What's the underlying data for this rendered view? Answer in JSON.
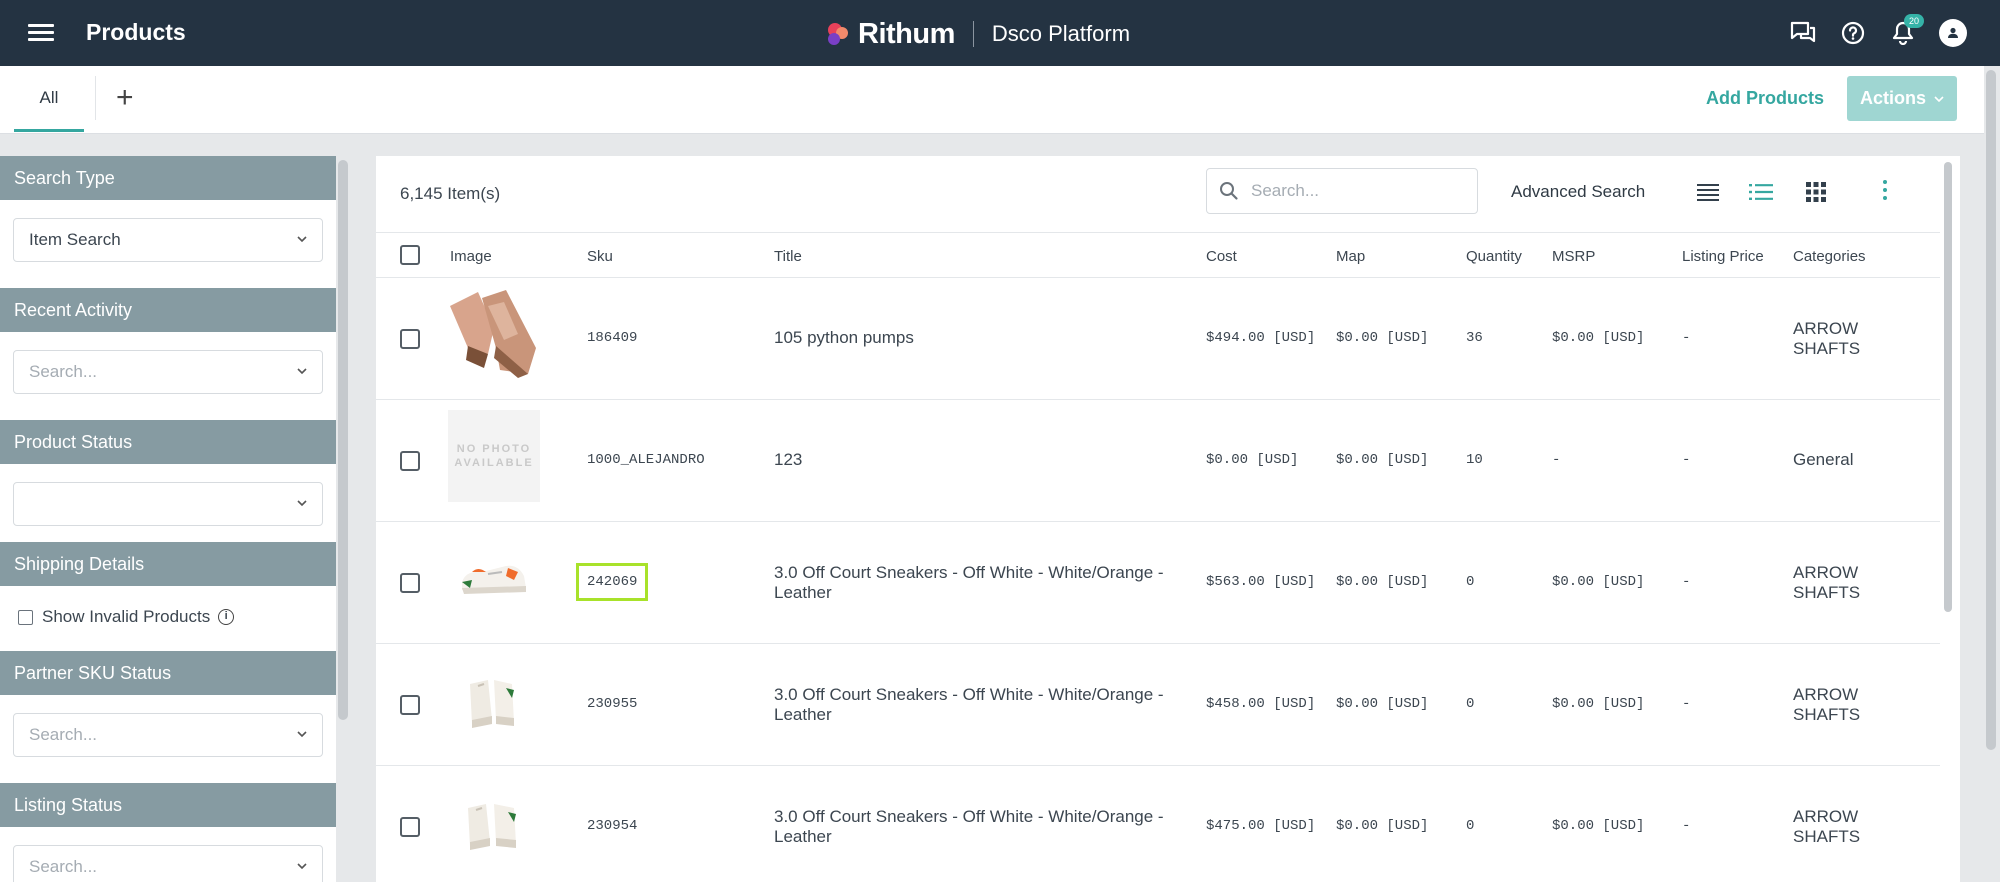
{
  "header": {
    "title": "Products",
    "brand_name": "Rithum",
    "platform": "Dsco Platform",
    "notification_count": "20"
  },
  "tabs": {
    "all_label": "All",
    "add_label": "+"
  },
  "toolbar": {
    "add_products": "Add Products",
    "actions": "Actions"
  },
  "sidebar": {
    "search_type": {
      "header": "Search Type",
      "value": "Item Search"
    },
    "recent_activity": {
      "header": "Recent Activity",
      "placeholder": "Search..."
    },
    "product_status": {
      "header": "Product Status",
      "value": ""
    },
    "shipping_details": {
      "header": "Shipping Details",
      "checkbox_label": "Show Invalid Products"
    },
    "partner_sku_status": {
      "header": "Partner SKU Status",
      "placeholder": "Search..."
    },
    "listing_status": {
      "header": "Listing Status",
      "placeholder": "Search..."
    }
  },
  "main": {
    "item_count": "6,145 Item(s)",
    "search_placeholder": "Search...",
    "advanced_search": "Advanced Search",
    "columns": [
      "Image",
      "Sku",
      "Title",
      "Cost",
      "Map",
      "Quantity",
      "MSRP",
      "Listing Price",
      "Categories"
    ],
    "no_photo": "NO PHOTO AVAILABLE",
    "rows": [
      {
        "sku": "186409",
        "title": "105 python pumps",
        "cost": "$494.00 [USD]",
        "map": "$0.00 [USD]",
        "quantity": "36",
        "msrp": "$0.00 [USD]",
        "listing_price": "-",
        "categories": "ARROW SHAFTS",
        "image": "pumps"
      },
      {
        "sku": "1000_ALEJANDRO",
        "title": "123",
        "cost": "$0.00 [USD]",
        "map": "$0.00 [USD]",
        "quantity": "10",
        "msrp": "-",
        "listing_price": "-",
        "categories": "General",
        "image": "none"
      },
      {
        "sku": "242069",
        "title": "3.0 Off Court Sneakers - Off White - White/Orange - Leather",
        "cost": "$563.00 [USD]",
        "map": "$0.00 [USD]",
        "quantity": "0",
        "msrp": "$0.00 [USD]",
        "listing_price": "-",
        "categories": "ARROW SHAFTS",
        "image": "sneaker-side"
      },
      {
        "sku": "230955",
        "title": "3.0 Off Court Sneakers - Off White - White/Orange - Leather",
        "cost": "$458.00 [USD]",
        "map": "$0.00 [USD]",
        "quantity": "0",
        "msrp": "$0.00 [USD]",
        "listing_price": "-",
        "categories": "ARROW SHAFTS",
        "image": "sneaker-pair"
      },
      {
        "sku": "230954",
        "title": "3.0 Off Court Sneakers - Off White - White/Orange - Leather",
        "cost": "$475.00 [USD]",
        "map": "$0.00 [USD]",
        "quantity": "0",
        "msrp": "$0.00 [USD]",
        "listing_price": "-",
        "categories": "ARROW SHAFTS",
        "image": "sneaker-pair"
      }
    ]
  },
  "colors": {
    "topbar": "#243342",
    "accent": "#35a7a0",
    "sidebar_header": "#869ba2",
    "highlight": "#a8e22a"
  }
}
